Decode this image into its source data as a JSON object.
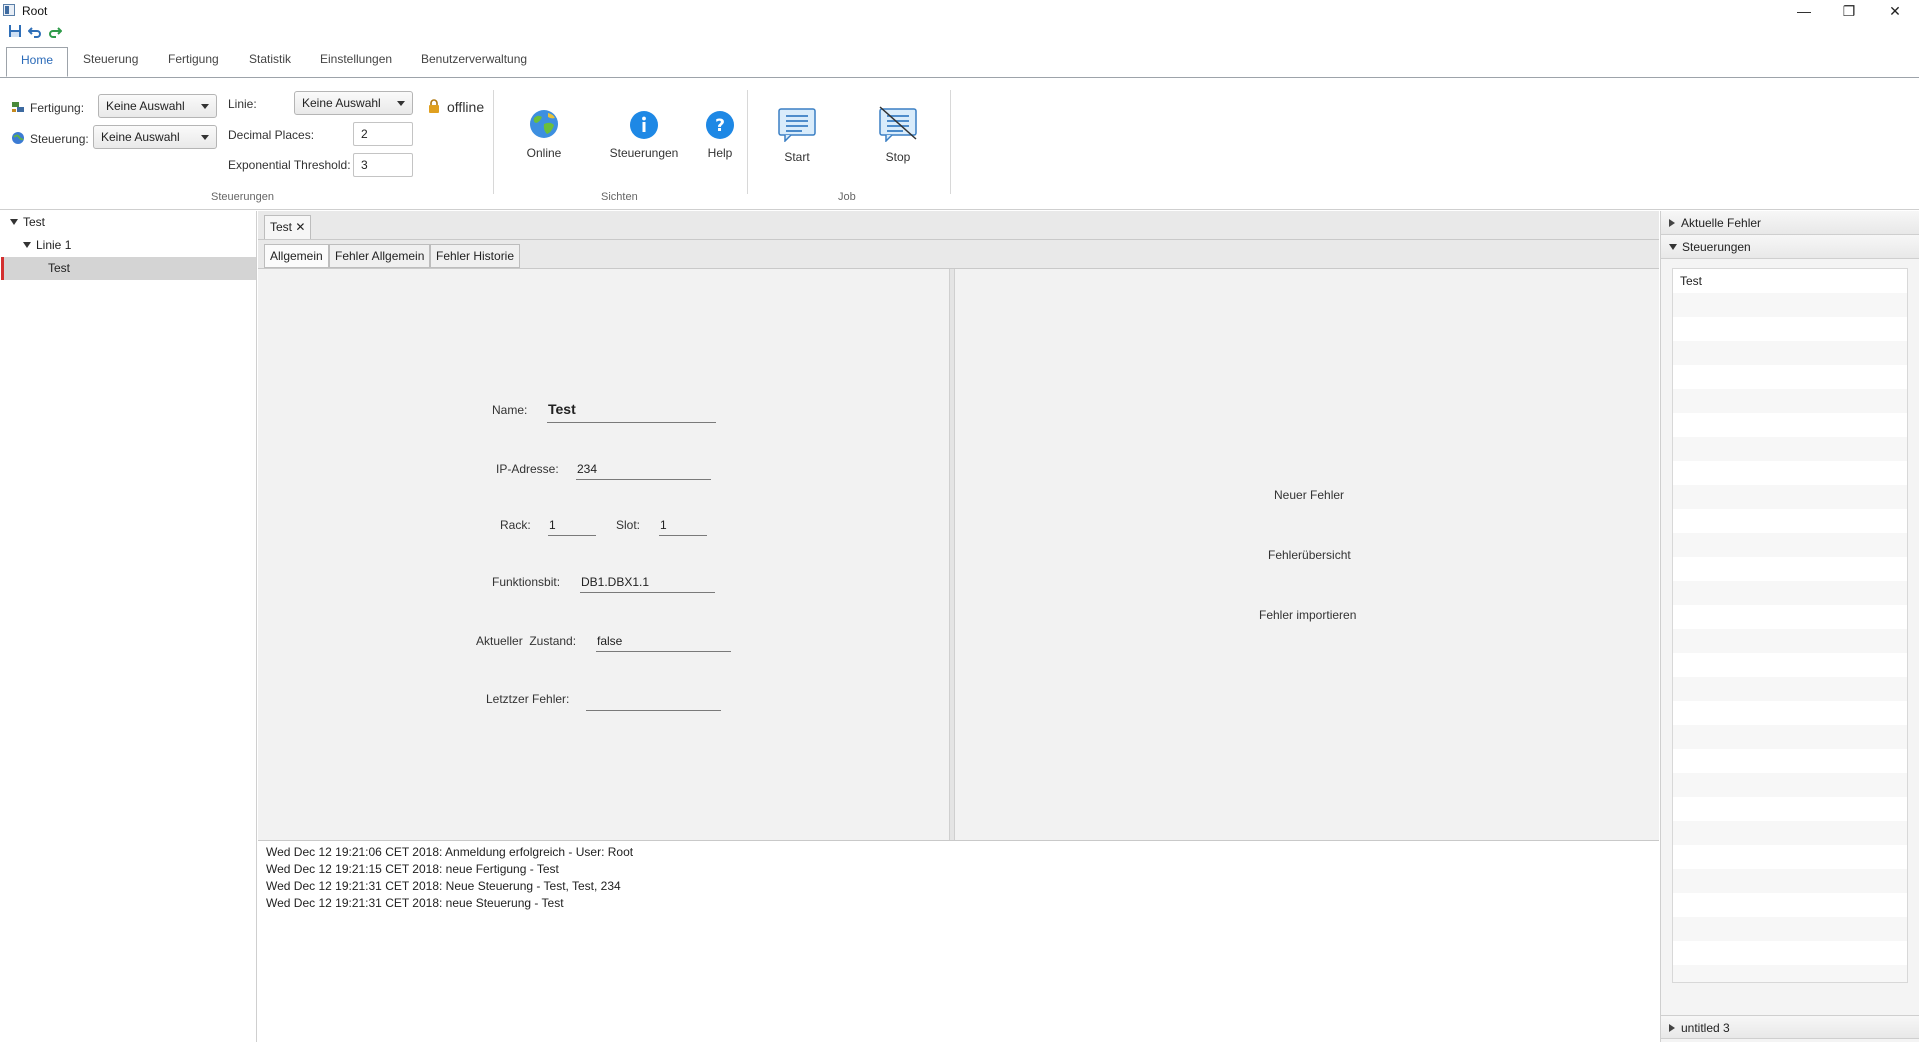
{
  "window": {
    "title": "Root",
    "minimize": "—",
    "maximize": "❐",
    "close": "✕"
  },
  "ribbon_tabs": [
    "Home",
    "Steuerung",
    "Fertigung",
    "Statistik",
    "Einstellungen",
    "Benutzerverwaltung"
  ],
  "ribbon": {
    "fertigung_label": "Fertigung:",
    "fertigung_value": "Keine Auswahl",
    "steuerung_label": "Steuerung:",
    "steuerung_value": "Keine Auswahl",
    "linie_label": "Linie:",
    "linie_value": "Keine Auswahl",
    "decimal_label": "Decimal Places:",
    "decimal_value": "2",
    "exp_label": "Exponential Threshold:",
    "exp_value": "3",
    "status": "offline",
    "group_steuerungen": "Steuerungen",
    "btn_online": "Online",
    "btn_steuerungen": "Steuerungen",
    "btn_help": "Help",
    "group_sichten": "Sichten",
    "btn_start": "Start",
    "btn_stop": "Stop",
    "group_job": "Job"
  },
  "tree": {
    "root": "Test",
    "line": "Linie 1",
    "leaf": "Test"
  },
  "doc_tab": {
    "label": "Test",
    "close": "✕"
  },
  "sub_tabs": [
    "Allgemein",
    "Fehler Allgemein",
    "Fehler Historie"
  ],
  "form": {
    "name_label": "Name:",
    "name_value": "Test",
    "ip_label": "IP-Adresse:",
    "ip_value": "234",
    "rack_label": "Rack:",
    "rack_value": "1",
    "slot_label": "Slot:",
    "slot_value": "1",
    "fb_label": "Funktionsbit:",
    "fb_value": "DB1.DBX1.1",
    "state_label": "Aktueller  Zustand:",
    "state_value": "false",
    "last_error_label": "Letztzer Fehler:",
    "last_error_value": ""
  },
  "actions": [
    "Neuer Fehler",
    "Fehlerübersicht",
    "Fehler importieren"
  ],
  "log": [
    "Wed Dec 12 19:21:06 CET 2018: Anmeldung erfolgreich - User: Root",
    "Wed Dec 12 19:21:15 CET 2018: neue Fertigung - Test",
    "Wed Dec 12 19:21:31 CET 2018: Neue Steuerung - Test, Test, 234",
    "Wed Dec 12 19:21:31 CET 2018: neue Steuerung - Test"
  ],
  "accordion": {
    "aktuelle_fehler": "Aktuelle Fehler",
    "steuerungen": "Steuerungen",
    "steuerungen_items": [
      "Test"
    ],
    "untitled": "untitled 3"
  },
  "colors": {
    "accent": "#2a6ab8",
    "help_blue": "#1e88e5",
    "lock": "#e0a020",
    "selection": "#d4d4d4",
    "selection_marker": "#d32f2f"
  }
}
